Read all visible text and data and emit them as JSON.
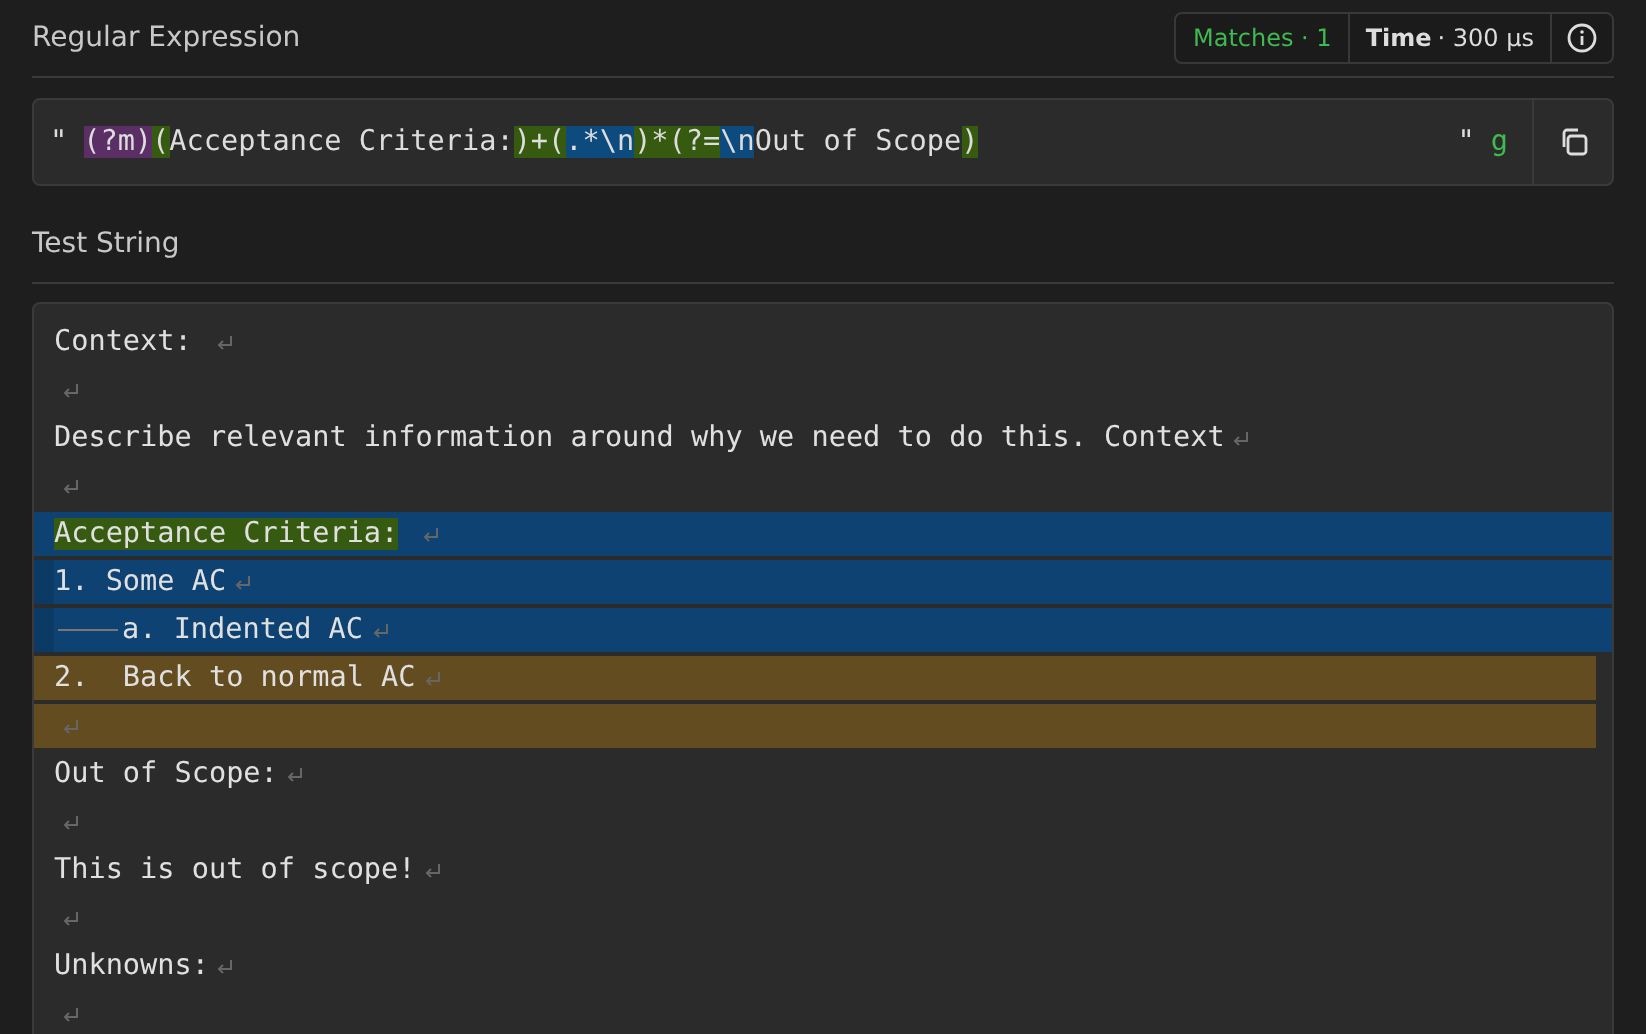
{
  "regex_panel": {
    "title": "Regular Expression",
    "matches": {
      "label": "Matches",
      "separator": "·",
      "value": "1"
    },
    "time": {
      "label": "Time",
      "separator": "·",
      "value": "300 µs"
    },
    "open_delimiter": "\"",
    "close_delimiter": "\"",
    "flags": "g",
    "tokens": [
      {
        "text": "(?m)",
        "kind": "flag-group"
      },
      {
        "text": "(",
        "kind": "group"
      },
      {
        "text": "Acceptance Criteria:",
        "kind": "plain"
      },
      {
        "text": ")+(",
        "kind": "group"
      },
      {
        "text": ".*\\n",
        "kind": "escape"
      },
      {
        "text": ")*(?=",
        "kind": "group"
      },
      {
        "text": "\\n",
        "kind": "escape"
      },
      {
        "text": "Out of Scope",
        "kind": "plain"
      },
      {
        "text": ")",
        "kind": "group"
      }
    ]
  },
  "test_panel": {
    "title": "Test String",
    "lines": [
      {
        "text": "Context: ",
        "kind": "plain"
      },
      {
        "kind": "plain"
      },
      {
        "text": "Describe relevant information around why we need to do this. Context",
        "kind": "plain"
      },
      {
        "kind": "plain"
      },
      {
        "text": "Acceptance Criteria:",
        "kind": "match-start"
      },
      {
        "text": "1. Some AC",
        "kind": "group-1"
      },
      {
        "text": "a. Indented AC",
        "kind": "group-1",
        "tab": true
      },
      {
        "text": "2.  Back to normal AC",
        "kind": "group-2"
      },
      {
        "kind": "group-2"
      },
      {
        "text": "Out of Scope:",
        "kind": "plain"
      },
      {
        "kind": "plain"
      },
      {
        "text": "This is out of scope!",
        "kind": "plain"
      },
      {
        "kind": "plain"
      },
      {
        "text": "Unknowns:",
        "kind": "plain"
      },
      {
        "kind": "plain"
      }
    ]
  }
}
